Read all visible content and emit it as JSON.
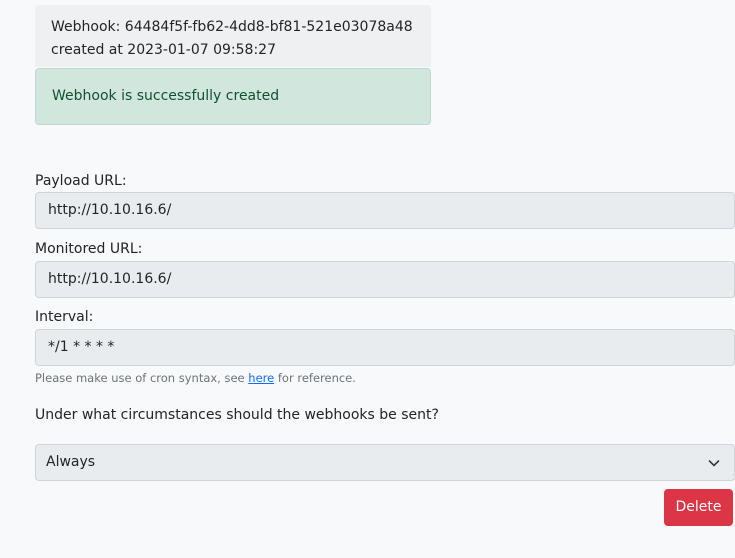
{
  "webhook_info": {
    "id_line": "Webhook: 64484f5f-fb62-4dd8-bf81-521e03078a48",
    "created_line": "created at 2023-01-07 09:58:27"
  },
  "alert": {
    "message": "Webhook is successfully created"
  },
  "form": {
    "payload_label": "Payload URL:",
    "payload_value": "http://10.10.16.6/",
    "monitored_label": "Monitored URL:",
    "monitored_value": "http://10.10.16.6/",
    "interval_label": "Interval:",
    "interval_value": "*/1 * * * *",
    "help_prefix": "Please make use of cron syntax, see ",
    "help_link": "here",
    "help_suffix": " for reference.",
    "question": "Under what circumstances should the webhooks be sent?",
    "condition_selected": "Always",
    "delete_label": "Delete"
  },
  "colors": {
    "success_bg": "#d1e7dd",
    "success_text": "#0f5132",
    "danger": "#dc3545",
    "link": "#0d6efd"
  }
}
